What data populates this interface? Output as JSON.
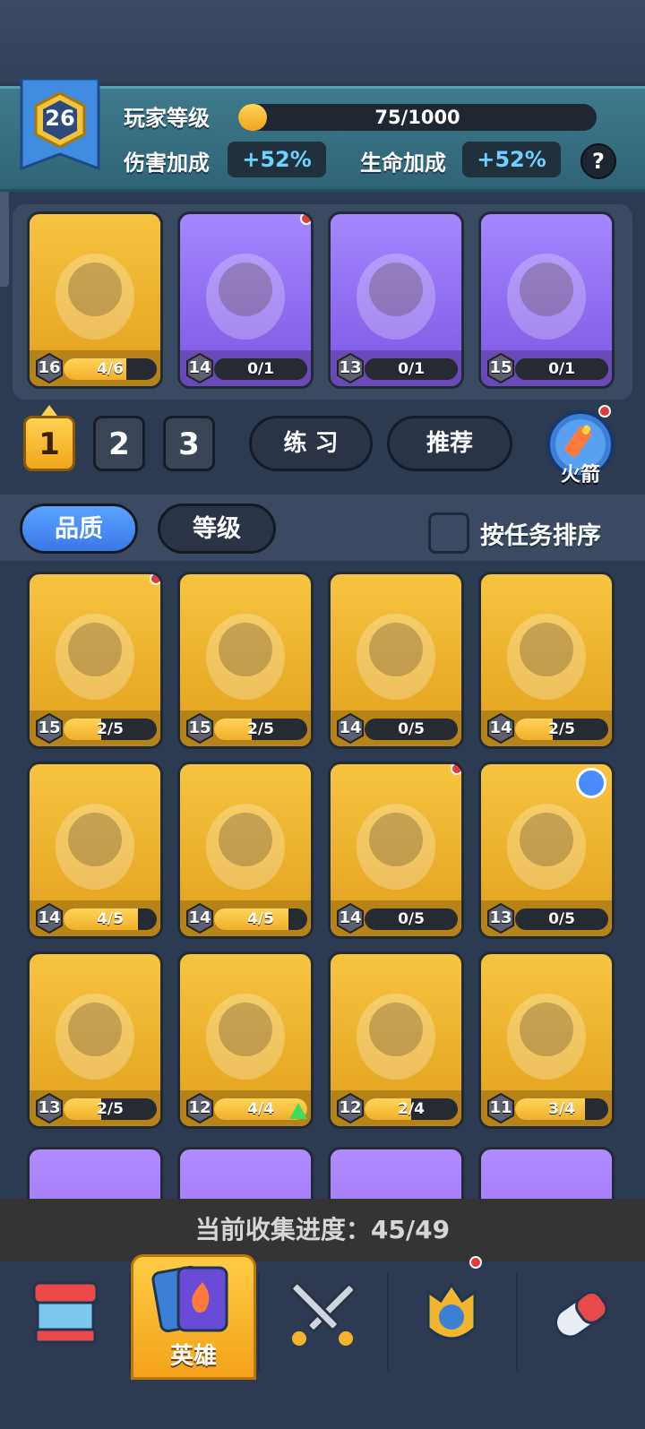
{
  "player": {
    "level": "26",
    "level_label": "玩家等级",
    "xp_text": "75/1000",
    "xp_fraction": 0.075,
    "damage_label": "伤害加成",
    "damage_value": "+52%",
    "hp_label": "生命加成",
    "hp_value": "+52%",
    "help": "?"
  },
  "team": [
    {
      "level": "16",
      "progress": "4/6",
      "fraction": 0.667,
      "rarity": "gold",
      "icon": "cloud-hero",
      "dot": false
    },
    {
      "level": "14",
      "progress": "0/1",
      "fraction": 0,
      "rarity": "purple",
      "icon": "jade-mage-hero",
      "dot": true
    },
    {
      "level": "13",
      "progress": "0/1",
      "fraction": 0,
      "rarity": "purple",
      "icon": "fox-chef-hero",
      "dot": false
    },
    {
      "level": "15",
      "progress": "0/1",
      "fraction": 0,
      "rarity": "purple",
      "icon": "pirate-captain-hero",
      "dot": false
    }
  ],
  "team_tabs": [
    "1",
    "2",
    "3"
  ],
  "practice_label": "练 习",
  "recommend_label": "推荐",
  "rocket_label": "火箭",
  "filters": {
    "quality": "品质",
    "level": "等级",
    "task_sort": "按任务排序"
  },
  "heroes": [
    {
      "level": "15",
      "progress": "2/5",
      "fraction": 0.4,
      "icon": "white-cat-hero",
      "dot": true
    },
    {
      "level": "15",
      "progress": "2/5",
      "fraction": 0.4,
      "icon": "tribal-girl-hero",
      "dot": false
    },
    {
      "level": "14",
      "progress": "0/5",
      "fraction": 0,
      "icon": "masked-shaman-hero",
      "dot": false
    },
    {
      "level": "14",
      "progress": "2/5",
      "fraction": 0.4,
      "icon": "storm-ghost-hero",
      "dot": false
    },
    {
      "level": "14",
      "progress": "4/5",
      "fraction": 0.8,
      "icon": "moon-elf-hero",
      "dot": false
    },
    {
      "level": "14",
      "progress": "4/5",
      "fraction": 0.8,
      "icon": "wolf-hero",
      "dot": false
    },
    {
      "level": "14",
      "progress": "0/5",
      "fraction": 0,
      "icon": "fox-mask-girl-hero",
      "dot": true
    },
    {
      "level": "13",
      "progress": "0/5",
      "fraction": 0,
      "icon": "rooster-hero",
      "dot": false,
      "badge": true
    },
    {
      "level": "13",
      "progress": "2/5",
      "fraction": 0.4,
      "icon": "knight-hero",
      "dot": false
    },
    {
      "level": "12",
      "progress": "4/4",
      "fraction": 1,
      "icon": "bat-hero",
      "dot": false,
      "upgrade": true
    },
    {
      "level": "12",
      "progress": "2/4",
      "fraction": 0.5,
      "icon": "spider-hero",
      "dot": false
    },
    {
      "level": "11",
      "progress": "3/4",
      "fraction": 0.75,
      "icon": "old-engineer-hero",
      "dot": false
    }
  ],
  "collection": "当前收集进度：45/49",
  "nav": {
    "shop": "shop-icon",
    "heroes": "英雄",
    "battle": "crossed-swords-icon",
    "rank": "crown-shield-icon",
    "gacha": "capsule-icon"
  },
  "colors": {
    "gold": "#f3b52e",
    "purple": "#8b62f0",
    "accent_blue": "#4a8cff",
    "red_dot": "#e23a3a"
  }
}
